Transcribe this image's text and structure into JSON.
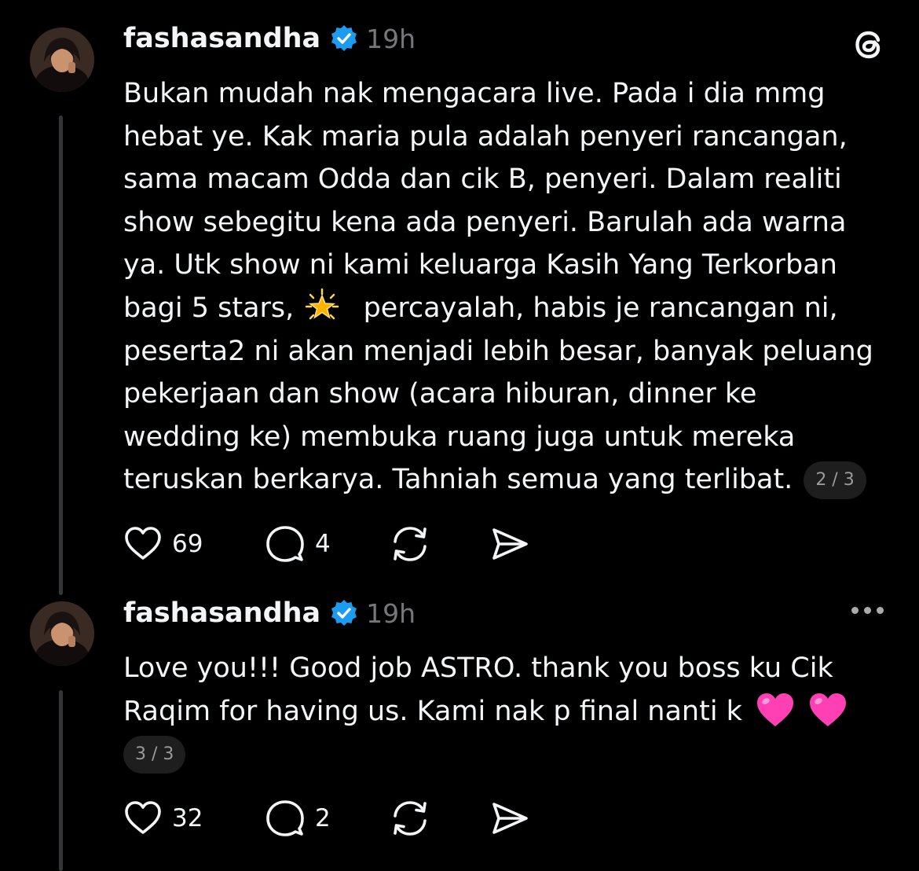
{
  "app": {
    "logo_icon": "threads-logo-icon"
  },
  "posts": [
    {
      "username": "fashasandha",
      "verified": true,
      "time": "19h",
      "lines": [
        "Bukan mudah nak mengacara live. Pada i dia mmg",
        "hebat ye. Kak maria pula adalah penyeri rancangan,",
        "sama macam Odda dan cik B, penyeri. Dalam realiti",
        "show sebegitu kena ada penyeri. Barulah ada warna",
        "ya. Utk show ni kami keluarga Kasih Yang Terkorban",
        "bagi 5 stars,",
        "percayalah, habis je rancangan ni,",
        "peserta2 ni akan menjadi lebih besar, banyak peluang",
        "pekerjaan dan show (acara hiburan, dinner ke",
        "wedding ke) membuka ruang juga untuk mereka",
        "teruskan berkarya. Tahniah semua yang terlibat."
      ],
      "page_badge": "2 / 3",
      "likes": "69",
      "replies": "4"
    },
    {
      "username": "fashasandha",
      "verified": true,
      "time": "19h",
      "lines": [
        "Love you!!! Good job ASTRO. thank you boss ku Cik",
        "Raqim for having us. Kami nak p final nanti k"
      ],
      "page_badge": "3 / 3",
      "likes": "32",
      "replies": "2"
    }
  ],
  "colors": {
    "background": "#000000",
    "text": "#f3f5f7",
    "muted": "#77777b",
    "verified": "#1d9bf0"
  }
}
